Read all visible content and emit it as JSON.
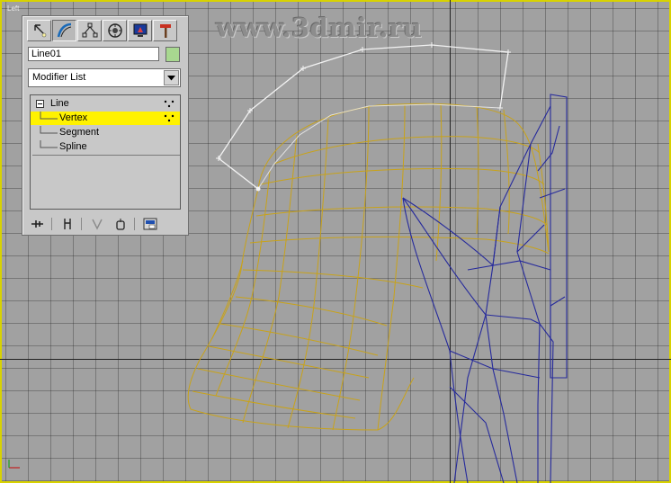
{
  "viewport": {
    "label": "Left",
    "watermark": "www.3dmir.ru"
  },
  "command_panel": {
    "tabs": [
      {
        "name": "create",
        "icon": "create-icon"
      },
      {
        "name": "modify",
        "icon": "modify-icon"
      },
      {
        "name": "hierarchy",
        "icon": "hierarchy-icon"
      },
      {
        "name": "motion",
        "icon": "motion-icon"
      },
      {
        "name": "display",
        "icon": "display-icon"
      },
      {
        "name": "utilities",
        "icon": "utilities-icon"
      }
    ],
    "active_tab": "modify",
    "object_name": "Line01",
    "object_color": "#a8d890",
    "modifier_list_label": "Modifier List",
    "stack": {
      "root": "Line",
      "subobjects": [
        "Vertex",
        "Segment",
        "Spline"
      ],
      "selected": "Vertex"
    },
    "selection_color": "#fff200"
  },
  "colors": {
    "spline": "#f2f2f2",
    "yellow_mesh": "#c8a21a",
    "blue_mesh": "#262a9c",
    "viewport_border": "#d8d200"
  }
}
